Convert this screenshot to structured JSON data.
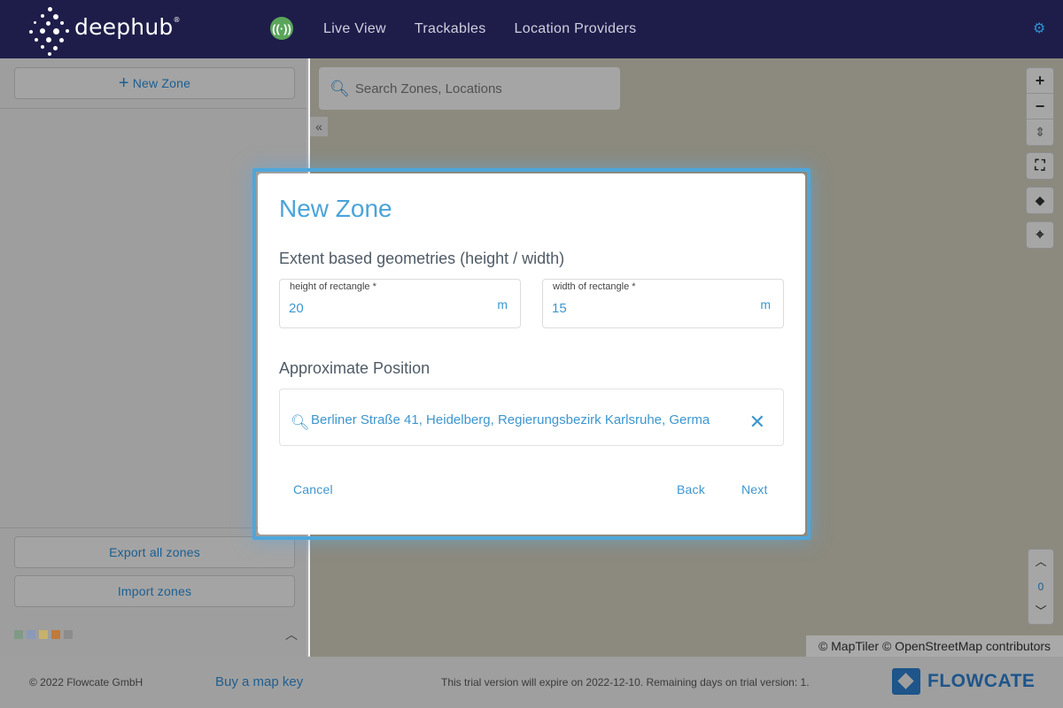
{
  "header": {
    "logo_text": "deephub",
    "logo_mark": "®",
    "nav": [
      "Live View",
      "Trackables",
      "Location Providers"
    ],
    "live_indicator_icon": "radio-signal-icon",
    "settings_icon": "gear-icon"
  },
  "sidebar": {
    "new_zone_label": "New Zone",
    "export_label": "Export all zones",
    "import_label": "Import zones",
    "swatch_colors": [
      "#7f9a85",
      "#8a9ab8",
      "#c6b26a",
      "#c07a3c",
      "#8c8c8c"
    ]
  },
  "map": {
    "search_placeholder": "Search Zones, Locations",
    "floor_value": "0",
    "attribution": "© MapTiler © OpenStreetMap contributors"
  },
  "dialog": {
    "title": "New Zone",
    "extent_section": "Extent based geometries (height / width)",
    "height_label": "height of rectangle *",
    "height_value": "20",
    "height_unit": "m",
    "width_label": "width of rectangle *",
    "width_value": "15",
    "width_unit": "m",
    "position_section": "Approximate Position",
    "position_value": "Berliner Straße 41, Heidelberg, Regierungsbezirk Karlsruhe, Germa",
    "cancel_label": "Cancel",
    "back_label": "Back",
    "next_label": "Next"
  },
  "footer": {
    "copyright": "© 2022 Flowcate GmbH",
    "buy_link": "Buy a map key",
    "trial_text": "This trial version will expire on 2022-12-10. Remaining days on trial version: 1.",
    "brand": "FLOWCATE"
  },
  "colors": {
    "header_bg": "#1e1d4a",
    "accent": "#4aa3da",
    "link": "#1f5f8f",
    "live_green": "#5aa55a"
  }
}
